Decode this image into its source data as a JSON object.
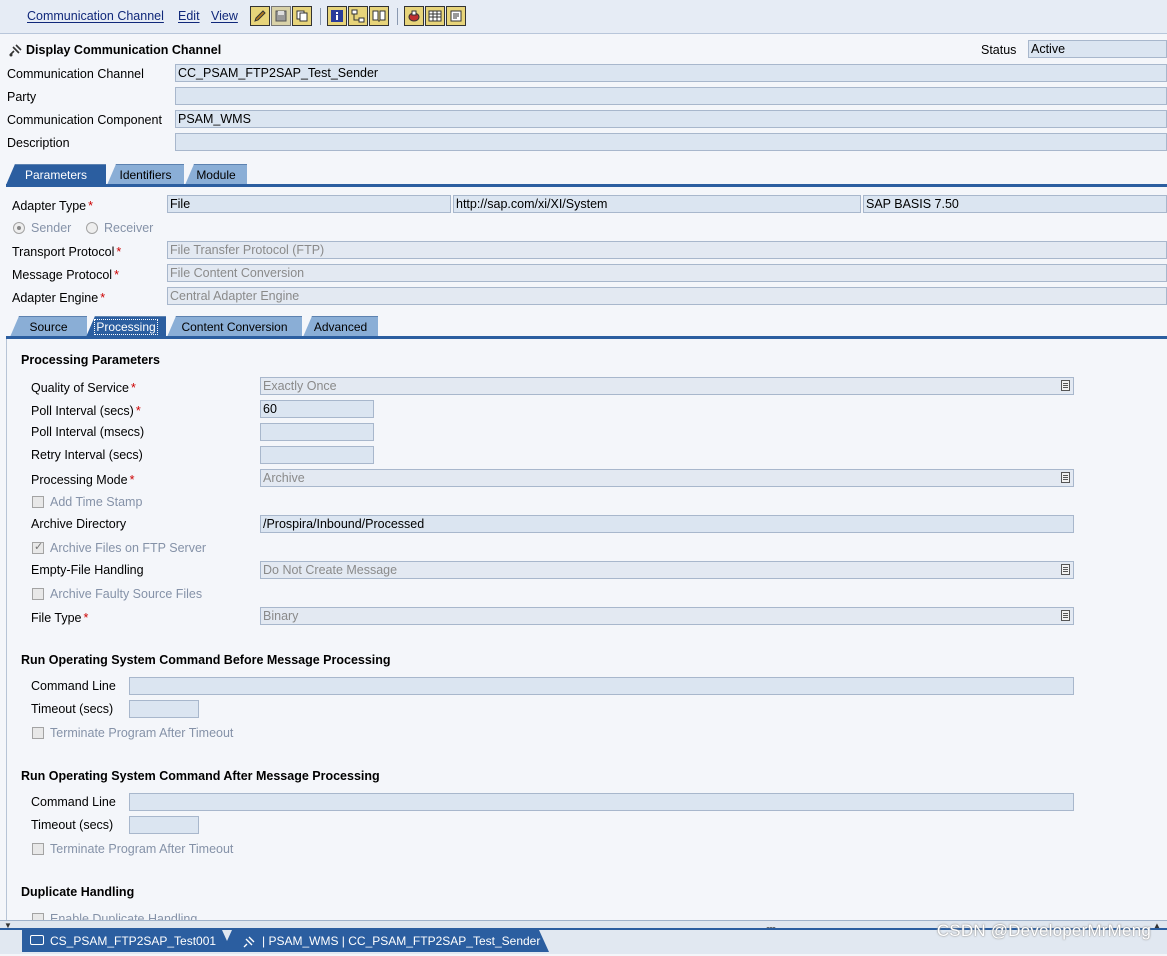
{
  "menu": {
    "items": [
      "Communication Channel",
      "Edit",
      "View"
    ]
  },
  "toolbar": {
    "icons": [
      "edit-pencil-icon",
      "save-icon",
      "copy-icon",
      "info-icon",
      "where-used-icon",
      "compare-icon",
      "shortcut-icon",
      "table-icon",
      "history-icon"
    ]
  },
  "header": {
    "title": "Display Communication Channel",
    "status_label": "Status",
    "status_value": "Active",
    "fields": {
      "channel_label": "Communication Channel",
      "channel_value": "CC_PSAM_FTP2SAP_Test_Sender",
      "party_label": "Party",
      "party_value": "",
      "component_label": "Communication Component",
      "component_value": "PSAM_WMS",
      "description_label": "Description",
      "description_value": ""
    }
  },
  "tabs_main": [
    "Parameters",
    "Identifiers",
    "Module"
  ],
  "params": {
    "adapter_type_label": "Adapter Type",
    "adapter_type_value": "File",
    "adapter_namespace": "http://sap.com/xi/XI/System",
    "adapter_swcv": "SAP BASIS 7.50",
    "sender_label": "Sender",
    "receiver_label": "Receiver",
    "transport_label": "Transport Protocol",
    "transport_value": "File Transfer Protocol (FTP)",
    "message_label": "Message Protocol",
    "message_value": "File Content Conversion",
    "engine_label": "Adapter Engine",
    "engine_value": "Central Adapter Engine"
  },
  "tabs_sub": [
    "Source",
    "Processing",
    "Content Conversion",
    "Advanced"
  ],
  "processing": {
    "section_title": "Processing Parameters",
    "qos_label": "Quality of Service",
    "qos_value": "Exactly Once",
    "poll_secs_label": "Poll Interval (secs)",
    "poll_secs_value": "60",
    "poll_msecs_label": "Poll Interval (msecs)",
    "retry_label": "Retry Interval (secs)",
    "mode_label": "Processing Mode",
    "mode_value": "Archive",
    "timestamp_label": "Add Time Stamp",
    "archive_dir_label": "Archive Directory",
    "archive_dir_value": "/Prospira/Inbound/Processed",
    "archive_ftp_label": "Archive Files on FTP Server",
    "empty_file_label": "Empty-File Handling",
    "empty_file_value": "Do Not Create Message",
    "archive_faulty_label": "Archive Faulty Source Files",
    "file_type_label": "File Type",
    "file_type_value": "Binary"
  },
  "cmd_before": {
    "title": "Run Operating System Command Before Message Processing",
    "cmd_label": "Command Line",
    "timeout_label": "Timeout (secs)",
    "terminate_label": "Terminate Program After Timeout"
  },
  "cmd_after": {
    "title": "Run Operating System Command After Message Processing",
    "cmd_label": "Command Line",
    "timeout_label": "Timeout (secs)",
    "terminate_label": "Terminate Program After Timeout"
  },
  "duplicate": {
    "title": "Duplicate Handling",
    "enable_label": "Enable Duplicate Handling"
  },
  "statusbar": {
    "tab1": "CS_PSAM_FTP2SAP_Test001",
    "tab2": "| PSAM_WMS | CC_PSAM_FTP2SAP_Test_Sender"
  },
  "watermark": "CSDN @DeveloperMrMeng"
}
